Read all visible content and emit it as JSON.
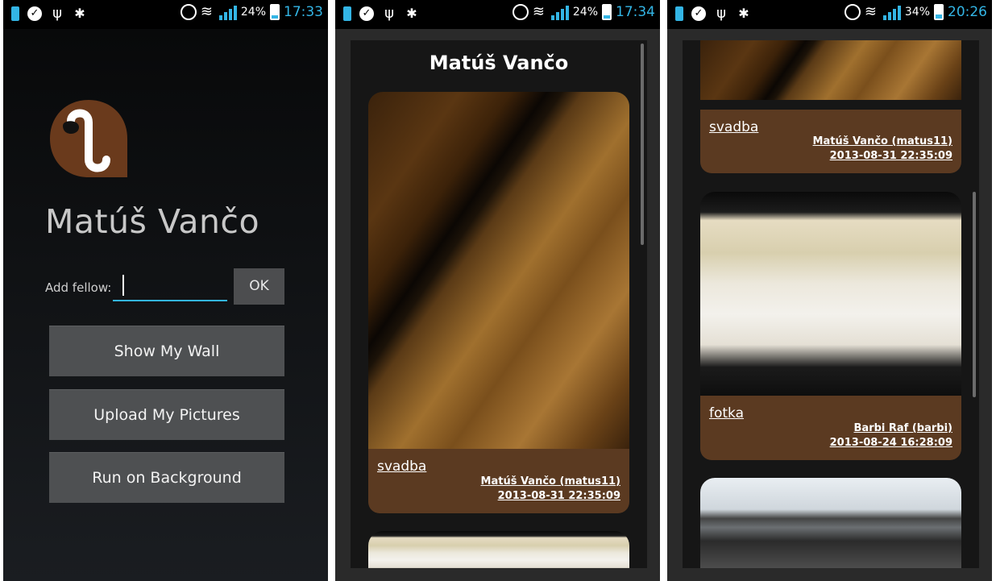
{
  "screens": [
    {
      "status": {
        "battery_pct": "24%",
        "time": "17:33",
        "battery_fill": 0.24
      },
      "app": {
        "name": "Matúš Vančo",
        "add_fellow_label": "Add fellow:",
        "add_fellow_value": "",
        "ok_label": "OK",
        "buttons": [
          "Show My Wall",
          "Upload My Pictures",
          "Run on Background"
        ]
      }
    },
    {
      "status": {
        "battery_pct": "24%",
        "time": "17:34",
        "battery_fill": 0.24
      },
      "wall": {
        "title": "Matúš Vančo",
        "posts": [
          {
            "title": "svadba",
            "author": "Matúš Vančo (matus11)",
            "date": "2013-08-31 22:35:09"
          }
        ]
      }
    },
    {
      "status": {
        "battery_pct": "34%",
        "time": "20:26",
        "battery_fill": 0.34
      },
      "wall": {
        "posts": [
          {
            "title": "svadba",
            "author": "Matúš Vančo (matus11)",
            "date": "2013-08-31 22:35:09"
          },
          {
            "title": "fotka",
            "author": "Barbi Raf (barbi)",
            "date": "2013-08-24 16:28:09"
          }
        ]
      }
    }
  ],
  "colors": {
    "accent": "#33b5e5",
    "post_meta_bg": "#5b3a21",
    "button_bg": "#4e5052"
  },
  "icons": [
    "battery-notification-icon",
    "check-icon",
    "usb-icon",
    "debug-icon",
    "alarm-icon",
    "wifi-icon",
    "signal-icon",
    "battery-icon"
  ]
}
